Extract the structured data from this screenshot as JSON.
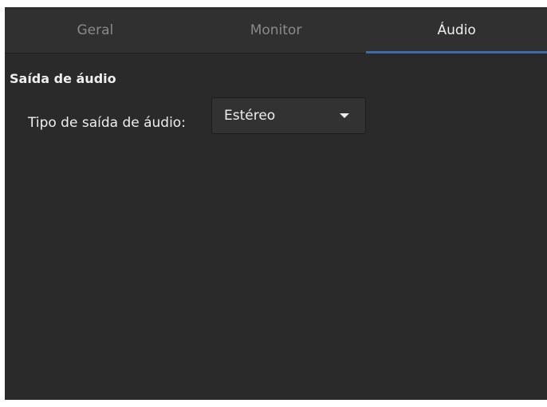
{
  "tabs": [
    {
      "label": "Geral",
      "active": false
    },
    {
      "label": "Monitor",
      "active": false
    },
    {
      "label": "Áudio",
      "active": true
    }
  ],
  "section": {
    "title": "Saída de áudio",
    "output_type_label": "Tipo de saída de áudio:",
    "output_type_value": "Estéreo"
  },
  "colors": {
    "background": "#2a2a2a",
    "tabbar": "#303030",
    "accent": "#3e6aa8",
    "text": "#eeeeec",
    "inactive_text": "#8a8a8a"
  },
  "icons": {
    "combo_arrow": "chevron-down-icon"
  }
}
